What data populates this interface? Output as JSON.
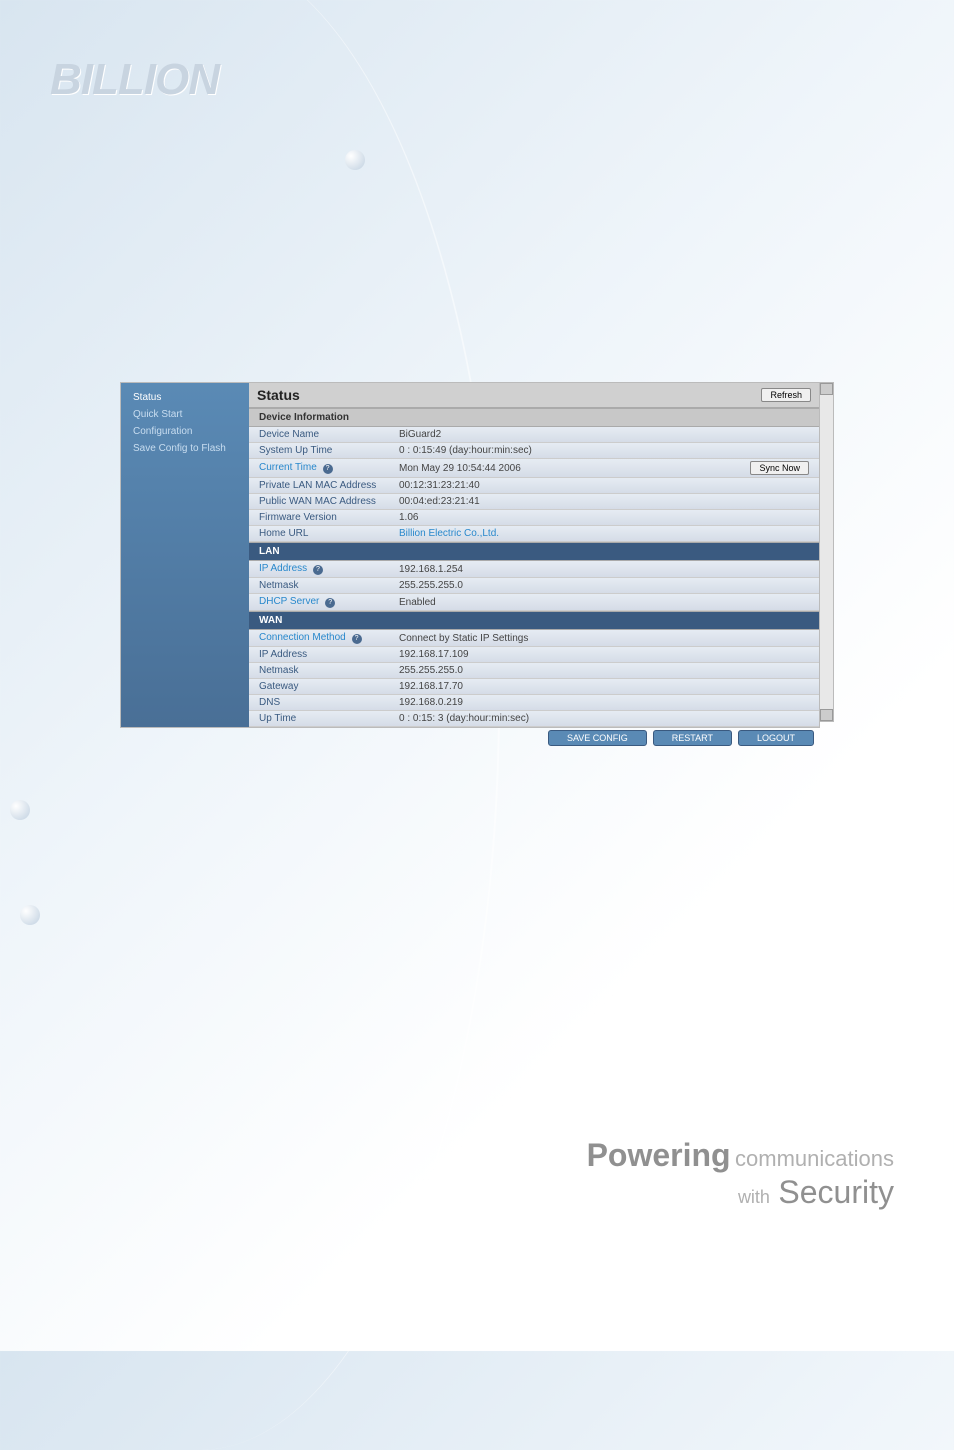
{
  "logo": "BILLION",
  "sidebar": {
    "items": [
      {
        "label": "Status"
      },
      {
        "label": "Quick Start"
      },
      {
        "label": "Configuration"
      },
      {
        "label": "Save Config to Flash"
      }
    ]
  },
  "page": {
    "title": "Status",
    "refresh": "Refresh",
    "sync": "Sync Now"
  },
  "sections": {
    "device_info": {
      "header": "Device Information",
      "rows": {
        "device_name": {
          "label": "Device Name",
          "value": "BiGuard2"
        },
        "uptime": {
          "label": "System Up Time",
          "value": "0 : 0:15:49 (day:hour:min:sec)"
        },
        "current_time": {
          "label": "Current Time",
          "value": "Mon May 29 10:54:44 2006"
        },
        "private_mac": {
          "label": "Private LAN MAC Address",
          "value": "00:12:31:23:21:40"
        },
        "public_mac": {
          "label": "Public WAN MAC Address",
          "value": "00:04:ed:23:21:41"
        },
        "firmware": {
          "label": "Firmware Version",
          "value": "1.06"
        },
        "home_url": {
          "label": "Home URL",
          "value": "Billion Electric Co.,Ltd."
        }
      }
    },
    "lan": {
      "header": "LAN",
      "rows": {
        "ip": {
          "label": "IP Address",
          "value": "192.168.1.254"
        },
        "netmask": {
          "label": "Netmask",
          "value": "255.255.255.0"
        },
        "dhcp": {
          "label": "DHCP Server",
          "value": "Enabled"
        }
      }
    },
    "wan": {
      "header": "WAN",
      "rows": {
        "conn": {
          "label": "Connection Method",
          "value": "Connect by Static IP Settings"
        },
        "ip": {
          "label": "IP Address",
          "value": "192.168.17.109"
        },
        "netmask": {
          "label": "Netmask",
          "value": "255.255.255.0"
        },
        "gateway": {
          "label": "Gateway",
          "value": "192.168.17.70"
        },
        "dns": {
          "label": "DNS",
          "value": "192.168.0.219"
        },
        "uptime": {
          "label": "Up Time",
          "value": "0 : 0:15: 3 (day:hour:min:sec)"
        }
      }
    }
  },
  "bottom_bar": {
    "save": "SAVE CONFIG",
    "restart": "RESTART",
    "logout": "LOGOUT"
  },
  "tagline": {
    "powering": "Powering",
    "comm": "communications",
    "with": "with",
    "security": "Security"
  }
}
